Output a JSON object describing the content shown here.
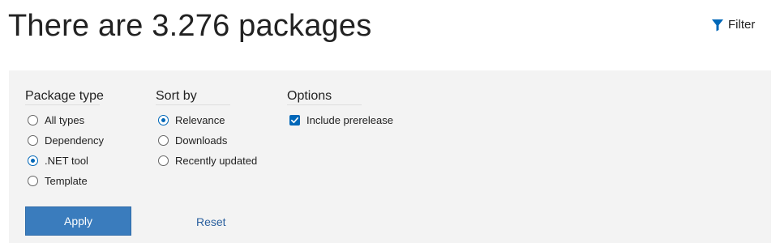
{
  "header": {
    "title": "There are 3.276 packages",
    "filter_label": "Filter",
    "filter_icon": "filter-icon"
  },
  "colors": {
    "accent": "#0067b8",
    "apply_button": "#3a7cbd",
    "panel_bg": "#f3f3f3",
    "link": "#2a5f9e"
  },
  "filters": {
    "package_type": {
      "title": "Package type",
      "options": [
        {
          "label": "All types",
          "checked": false
        },
        {
          "label": "Dependency",
          "checked": false
        },
        {
          "label": ".NET tool",
          "checked": true
        },
        {
          "label": "Template",
          "checked": false
        }
      ]
    },
    "sort_by": {
      "title": "Sort by",
      "options": [
        {
          "label": "Relevance",
          "checked": true
        },
        {
          "label": "Downloads",
          "checked": false
        },
        {
          "label": "Recently updated",
          "checked": false
        }
      ]
    },
    "options": {
      "title": "Options",
      "items": [
        {
          "label": "Include prerelease",
          "checked": true
        }
      ]
    },
    "apply_label": "Apply",
    "reset_label": "Reset"
  }
}
